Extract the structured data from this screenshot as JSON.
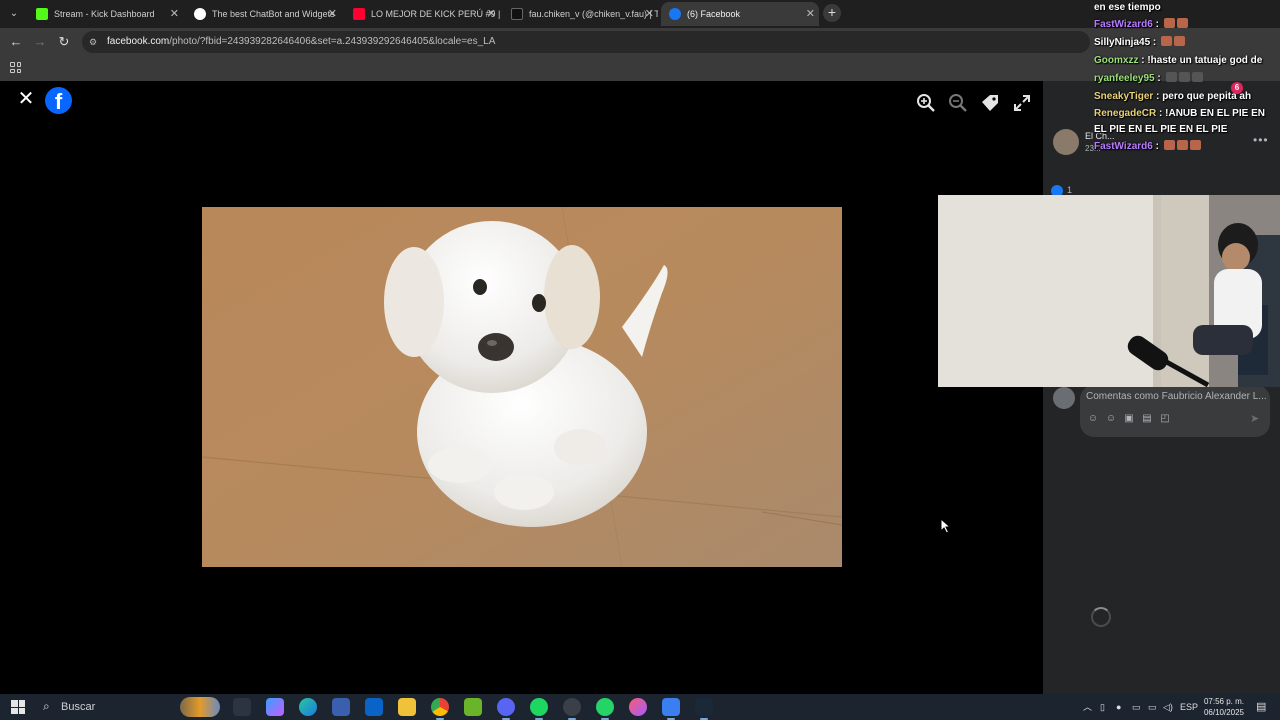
{
  "browser": {
    "tabs": [
      {
        "label": "Stream - Kick Dashboard",
        "color": "#53fc18"
      },
      {
        "label": "The best ChatBot and Widgets",
        "color": "#ffffff"
      },
      {
        "label": "LO MEJOR DE KICK PERÚ #9 | F",
        "color": "#ff0033"
      },
      {
        "label": "fau.chiken_v (@chiken_v.fau) | T",
        "color": "#000000"
      },
      {
        "label": "(6) Facebook",
        "color": "#1877f2"
      }
    ],
    "url_domain": "facebook.com",
    "url_path": "/photo/?fbid=243939282646406&set=a.243939292646405&locale=es_LA"
  },
  "viewer": {
    "brand_letter": "f"
  },
  "side": {
    "poster_name": "El Ch...",
    "poster_date": "23...",
    "like_count": "1",
    "comment_placeholder": "Comentas como Faubricio Alexander L...",
    "send_icon": "send-icon"
  },
  "chat": {
    "lines": [
      {
        "user": "",
        "text": "en ese tiempo",
        "emotes": 0,
        "color": "#ffffff"
      },
      {
        "user": "FastWizard6",
        "text": "",
        "emotes": 2,
        "color": "#b87cff"
      },
      {
        "user": "SillyNinja45",
        "text": "",
        "emotes": 2,
        "color": "#ffffff"
      },
      {
        "user": "Goomxzz",
        "text": "!haste un tatuaje god de",
        "emotes": 1,
        "color": "#9be07a"
      },
      {
        "user": "ryanfeeley95",
        "text": "",
        "emotes": 3,
        "color": "#9be07a"
      },
      {
        "user": "SneakyTiger",
        "text": "pero que pepita ah",
        "emotes": 0,
        "color": "#e8d27a"
      },
      {
        "user": "RenegadeCR",
        "text": "!ANUB EN EL PIE EN EL PIE EN EL PIE EN EL PIE",
        "emotes": 0,
        "color": "#e8d27a"
      },
      {
        "user": "FastWizard6",
        "text": "",
        "emotes": 3,
        "color": "#b87cff"
      }
    ],
    "badge_count": "6"
  },
  "taskbar": {
    "search_label": "Buscar",
    "lang": "ESP",
    "time": "07:56 p. m.",
    "date": "06/10/2025"
  }
}
